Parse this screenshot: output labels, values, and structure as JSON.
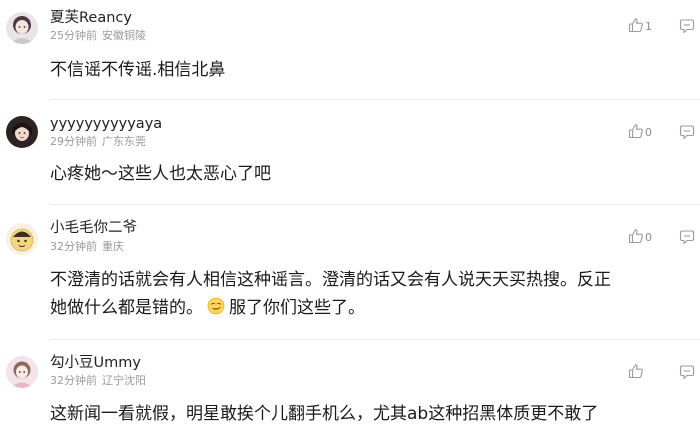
{
  "comments": [
    {
      "username": "夏芙Reancy",
      "time": "25分钟前",
      "location": "安徽铜陵",
      "text": "不信谣不传谣.相信北鼻",
      "likes": "1",
      "avatar_icon": "girl-avatar-icon"
    },
    {
      "username": "yyyyyyyyyyaya",
      "time": "29分钟前",
      "location": "广东东莞",
      "text": "心疼她～这些人也太恶心了吧",
      "likes": "0",
      "avatar_icon": "dark-hair-avatar-icon"
    },
    {
      "username": "小毛毛你二爷",
      "time": "32分钟前",
      "location": "重庆",
      "text_line1": "不澄清的话就会有人相信这种谣言。澄清的话又会有人说天天买热搜。反正",
      "text_line2a": "她做什么都是错的。",
      "text_line2b": "服了你们这些了。",
      "likes": "0",
      "avatar_icon": "cartoon-avatar-icon",
      "emoji_icon": "smirk-emoji-icon"
    },
    {
      "username": "勾小豆Ummy",
      "time": "32分钟前",
      "location": "辽宁沈阳",
      "text": "这新闻一看就假，明星敢挨个儿翻手机么，尤其ab这种招黑体质更不敢了",
      "likes": "",
      "avatar_icon": "pink-avatar-icon"
    }
  ],
  "colors": {
    "username": "#222222",
    "meta": "#9a9a9a",
    "icon": "#9b9b9b",
    "divider": "#ececec"
  }
}
